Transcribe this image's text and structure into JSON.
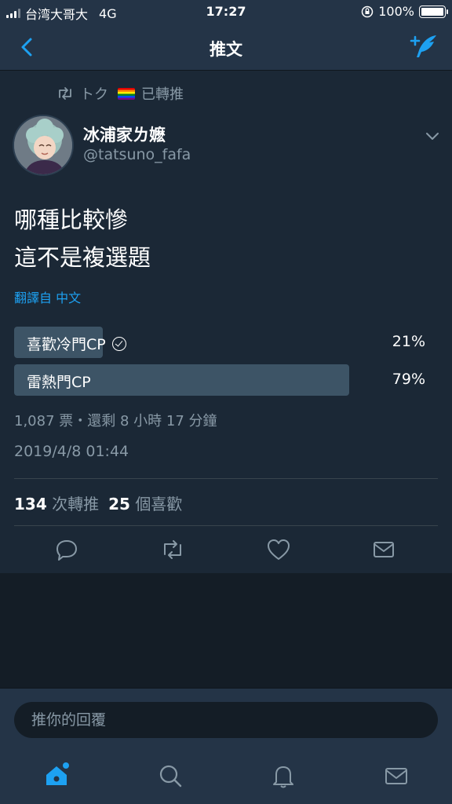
{
  "status_bar": {
    "carrier": "台湾大哥大",
    "network": "4G",
    "time": "17:27",
    "battery": "100%"
  },
  "nav": {
    "title": "推文",
    "back_icon": "chevron-left-icon",
    "compose_icon": "compose-feather-icon"
  },
  "tweet": {
    "retweeted_by_name": "トク",
    "retweeted_label": "已轉推",
    "author_name": "冰浦家ㄌ嬷",
    "author_handle": "@tatsuno_fafa",
    "text_line1": "哪種比較慘",
    "text_line2": "這不是複選題",
    "translate": "翻譯自 中文",
    "poll": {
      "options": [
        {
          "label": "喜歡冷門CP",
          "percent_text": "21%",
          "percent": 21,
          "selected": true
        },
        {
          "label": "雷熱門CP",
          "percent_text": "79%",
          "percent": 79,
          "selected": false
        }
      ],
      "meta": "1,087 票・還剩 8 小時 17 分鐘"
    },
    "timestamp": "2019/4/8 01:44",
    "stats": {
      "retweets_count": "134",
      "retweets_label": "次轉推",
      "likes_count": "25",
      "likes_label": "個喜歡"
    }
  },
  "reply": {
    "placeholder": "推你的回覆"
  },
  "colors": {
    "accent": "#1da1f2",
    "background": "#141d26",
    "card": "#1b2836",
    "bar": "#243447",
    "muted": "#8899a6"
  }
}
